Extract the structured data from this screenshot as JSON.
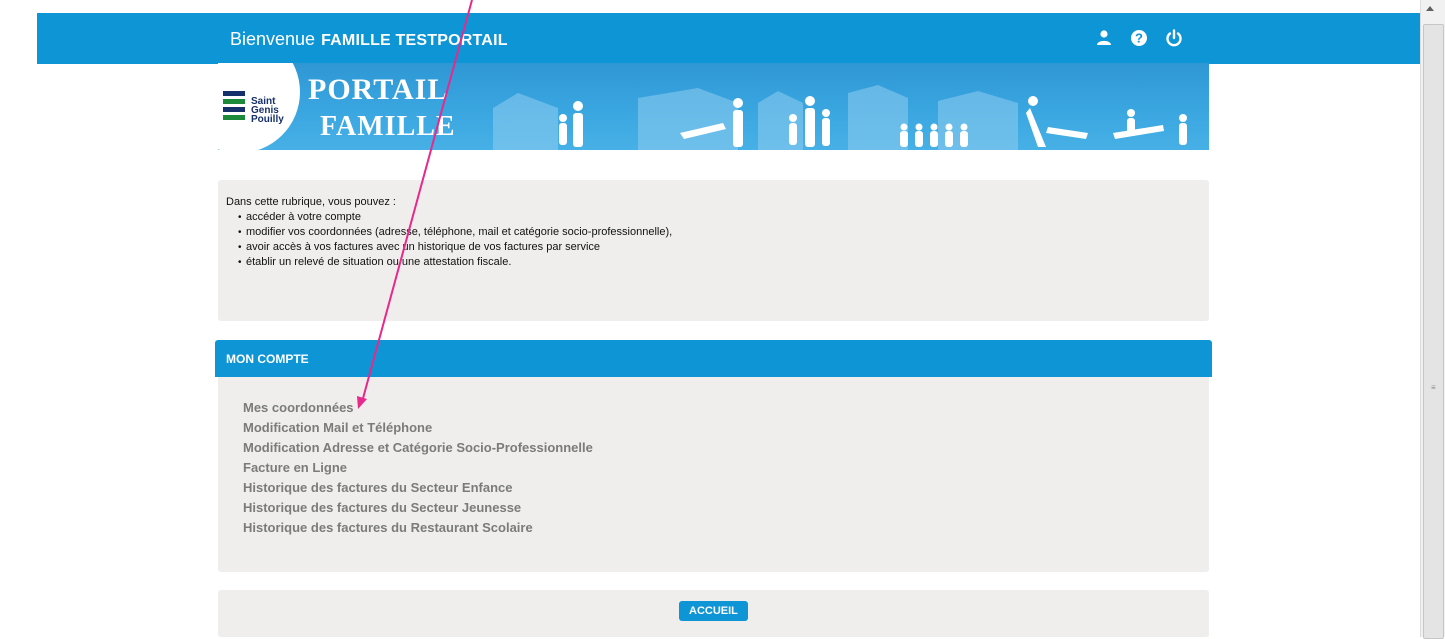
{
  "header": {
    "welcome_label": "Bienvenue",
    "family_name": "FAMILLE TESTPORTAIL",
    "icons": [
      "user-icon",
      "help-icon",
      "power-icon"
    ],
    "accent_color": "#0d95d6"
  },
  "banner": {
    "logo_lines": [
      "Saint",
      "Genis",
      "Pouilly"
    ],
    "title_line1": "PORTAIL",
    "title_line2": "FAMILLE"
  },
  "intro": {
    "lead": "Dans cette rubrique, vous pouvez :",
    "items": [
      "accéder à votre compte",
      "modifier vos coordonnées (adresse, téléphone, mail et catégorie socio-professionnelle),",
      "avoir accès à vos factures avec un historique de vos factures par service",
      "établir un relevé de situation ou une attestation fiscale."
    ]
  },
  "account": {
    "section_title": "MON COMPTE",
    "links": [
      "Mes coordonnées",
      "Modification Mail et Téléphone",
      "Modification Adresse et Catégorie Socio-Professionnelle",
      "Facture en Ligne",
      "Historique des factures du Secteur Enfance",
      "Historique des factures du Secteur Jeunesse",
      "Historique des factures du Restaurant Scolaire"
    ]
  },
  "footer": {
    "home_button": "ACCUEIL"
  },
  "annotation": {
    "arrow_color": "#e8288a"
  }
}
